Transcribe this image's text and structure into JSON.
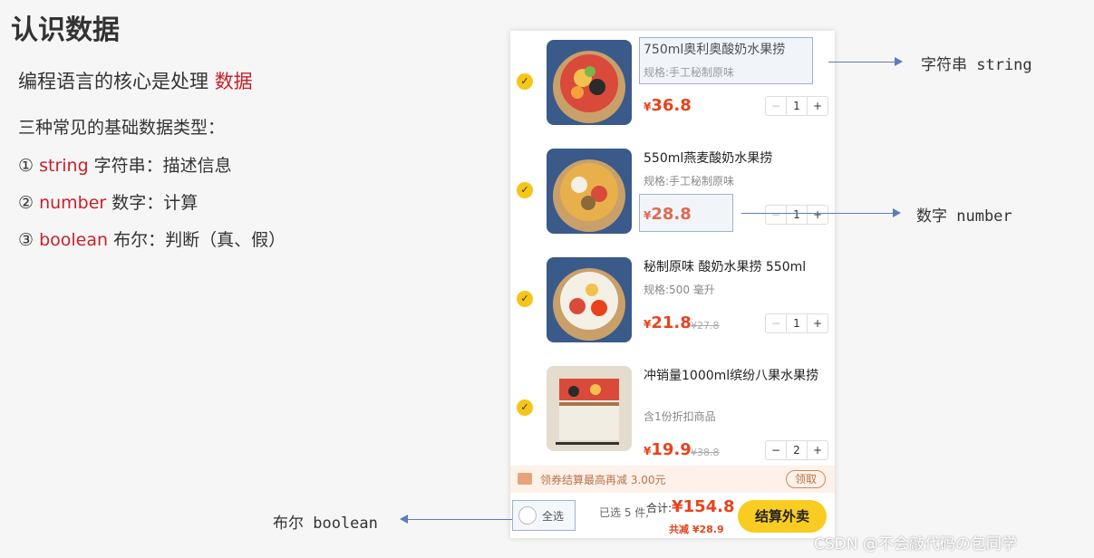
{
  "slide": {
    "title": "认识数据",
    "core_prefix": "编程语言的核心是处理 ",
    "core_highlight": "数据",
    "types_head": "三种常见的基础数据类型：",
    "types": [
      {
        "num": "①",
        "kw": "string",
        "desc": " 字符串：描述信息"
      },
      {
        "num": "②",
        "kw": "number",
        "desc": " 数字：计算"
      },
      {
        "num": "③",
        "kw": "boolean",
        "desc": " 布尔：判断（真、假）"
      }
    ]
  },
  "cart": {
    "items": [
      {
        "name": "750ml奥利奥酸奶水果捞",
        "spec": "规格:手工秘制原味",
        "currency": "¥",
        "price": "36.8",
        "old_price": "",
        "qty": "1",
        "checked_icon": "check-icon"
      },
      {
        "name": "550ml燕麦酸奶水果捞",
        "spec": "规格:手工秘制原味",
        "currency": "¥",
        "price": "28.8",
        "old_price": "",
        "qty": "1",
        "checked_icon": "check-icon"
      },
      {
        "name": "秘制原味 酸奶水果捞 550ml",
        "spec": "规格:500 毫升",
        "currency": "¥",
        "price": "21.8",
        "old_price": "¥27.8",
        "qty": "1",
        "checked_icon": "check-icon"
      },
      {
        "name": "冲销量1000ml缤纷八果水果捞",
        "spec": "含1份折扣商品",
        "currency": "¥",
        "price": "19.9",
        "old_price": "¥38.8",
        "qty": "2",
        "checked_icon": "check-icon"
      }
    ],
    "stepper_minus": "−",
    "stepper_plus": "+",
    "coupon_text": "领券结算最高再减 3.00元",
    "coupon_button": "领取",
    "select_all": "全选",
    "selected_count": "已选 5 件,",
    "total_label": "合计:",
    "total_value": "¥154.8",
    "discount": "共减 ¥28.9",
    "checkout": "结算外卖"
  },
  "annotations": {
    "string": "字符串 string",
    "number": "数字 number",
    "boolean": "布尔 boolean"
  },
  "watermark": "CSDN @不会敲代码の包同学",
  "colors": {
    "highlight": "#c8202a",
    "price": "#e8431c",
    "checkout": "#f8cc20",
    "arrow": "#5a7dbb"
  }
}
